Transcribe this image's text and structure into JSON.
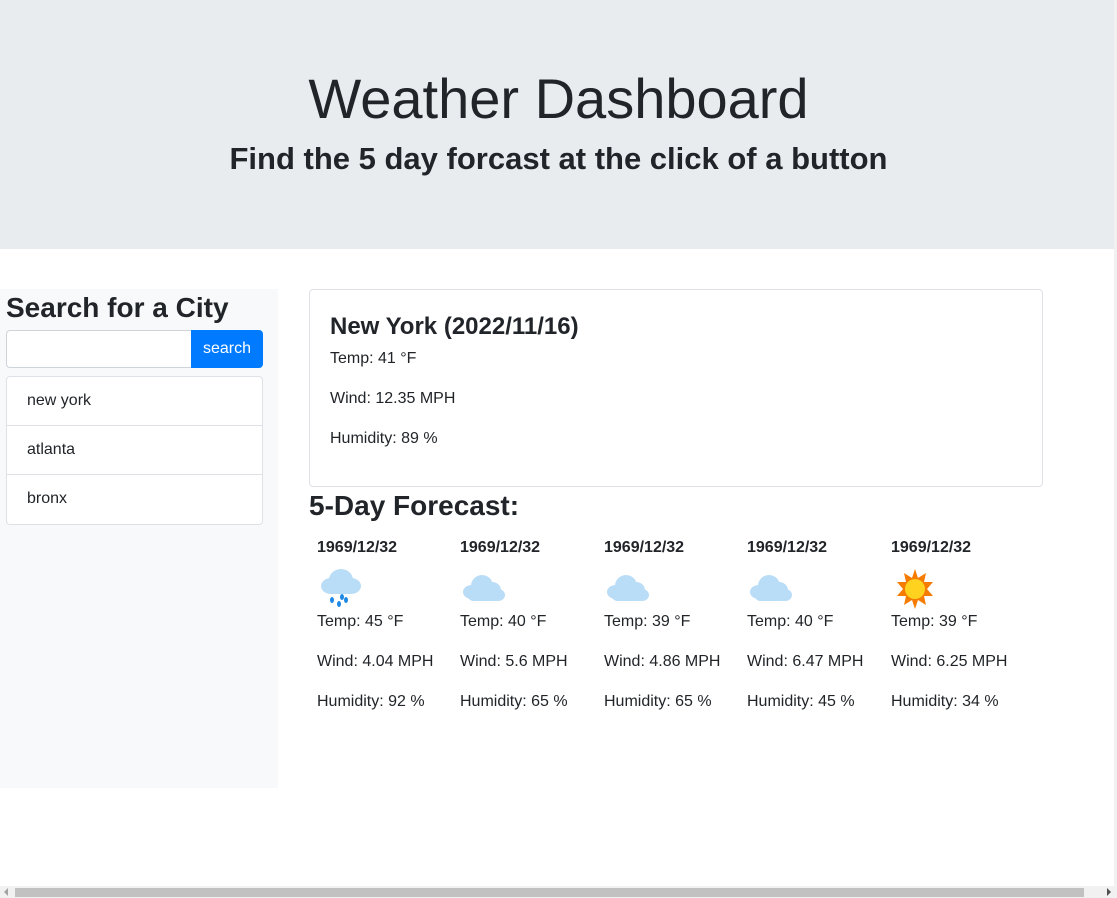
{
  "header": {
    "title": "Weather Dashboard",
    "subtitle": "Find the 5 day forcast at the click of a button"
  },
  "sidebar": {
    "heading": "Search for a City",
    "search_value": "",
    "search_placeholder": "",
    "search_button_label": "search",
    "history": [
      "new york",
      "atlanta",
      "bronx"
    ]
  },
  "current": {
    "title": "New York (2022/11/16)",
    "temp": "Temp: 41 °F",
    "wind": "Wind: 12.35 MPH",
    "humidity": "Humidity: 89 %"
  },
  "forecast": {
    "heading": "5-Day Forecast:",
    "days": [
      {
        "date": "1969/12/32",
        "icon": "rain-cloud-icon",
        "temp": "Temp: 45 °F",
        "wind": "Wind: 4.04 MPH",
        "humidity": "Humidity: 92 %"
      },
      {
        "date": "1969/12/32",
        "icon": "cloud-icon",
        "temp": "Temp: 40 °F",
        "wind": "Wind: 5.6 MPH",
        "humidity": "Humidity: 65 %"
      },
      {
        "date": "1969/12/32",
        "icon": "cloud-icon",
        "temp": "Temp: 39 °F",
        "wind": "Wind: 4.86 MPH",
        "humidity": "Humidity: 65 %"
      },
      {
        "date": "1969/12/32",
        "icon": "cloud-icon",
        "temp": "Temp: 40 °F",
        "wind": "Wind: 6.47 MPH",
        "humidity": "Humidity: 45 %"
      },
      {
        "date": "1969/12/32",
        "icon": "sun-icon",
        "temp": "Temp: 39 °F",
        "wind": "Wind: 6.25 MPH",
        "humidity": "Humidity: 34 %"
      }
    ]
  },
  "colors": {
    "jumbotron_bg": "#e9ecef",
    "sidebar_bg": "#f8f9fa",
    "button_bg": "#007bff",
    "cloud": "#b9dcf7",
    "rain": "#1e88e5",
    "sun_outer": "#f57c00",
    "sun_inner": "#ffd21f"
  }
}
